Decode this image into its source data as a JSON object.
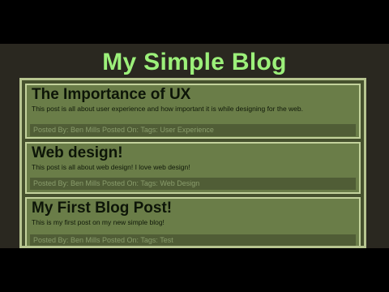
{
  "blog": {
    "title": "My Simple Blog"
  },
  "posts": [
    {
      "title": "The Importance of UX",
      "body": "This post is all about user experience and how important it is while designing for the web.",
      "meta": "Posted By: Ben Mills Posted On: Tags: User Experience"
    },
    {
      "title": "Web design!",
      "body": "This post is all about web design! I love web design!",
      "meta": "Posted By: Ben Mills Posted On: Tags: Web Design"
    },
    {
      "title": "My First Blog Post!",
      "body": "This is my first post on my new simple blog!",
      "meta": "Posted By: Ben Mills Posted On: Tags: Test"
    }
  ],
  "colors": {
    "title_green": "#9cf07a",
    "post_background": "#6a7d48",
    "post_border": "#c3d29c",
    "meta_bar": "#505d36"
  }
}
